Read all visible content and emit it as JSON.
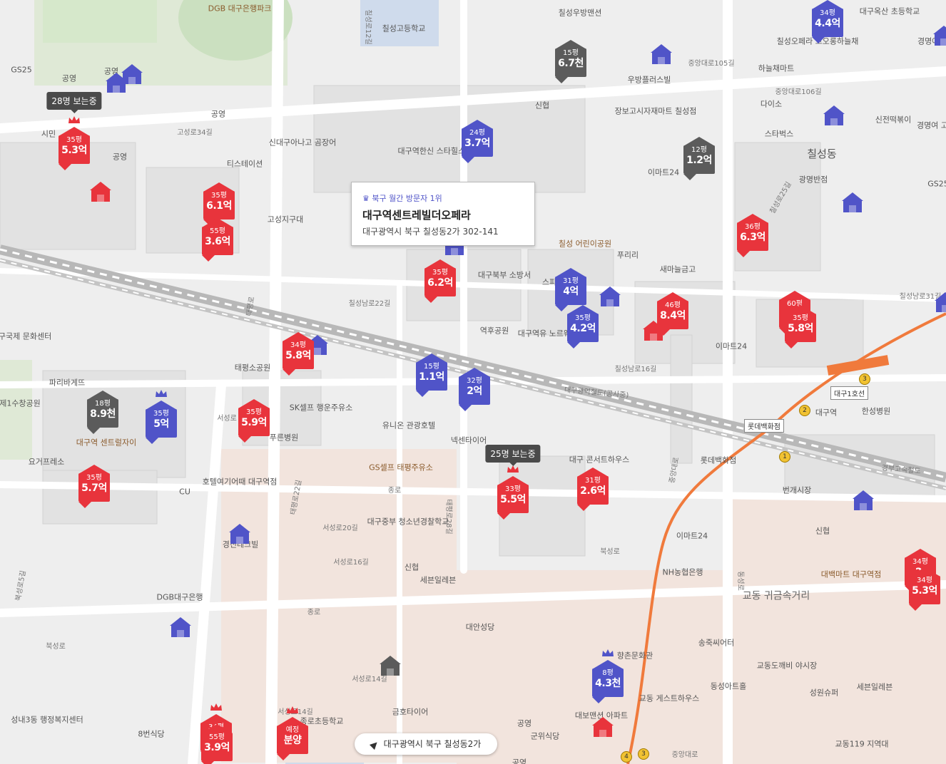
{
  "popup": {
    "rank_label": "♛ 북구 월간 방문자 1위",
    "name": "대구역센트레빌더오페라",
    "address": "대구광역시 북구 칠성동2가 302-141"
  },
  "location_bar": {
    "text": "대구광역시 북구 칠성동2가"
  },
  "viewing_badges": [
    {
      "text": "28명 보는중"
    },
    {
      "text": "25명 보는중"
    }
  ],
  "markers": [
    {
      "color": "red",
      "size": "35평",
      "price": "5.3억",
      "crown": true
    },
    {
      "color": "red",
      "size": "35평",
      "price": "6.1억",
      "crown": false
    },
    {
      "color": "red",
      "size": "55평",
      "price": "3.6억",
      "crown": false
    },
    {
      "color": "blue",
      "size": "24평",
      "price": "3.7억",
      "crown": false
    },
    {
      "color": "gray",
      "size": "15평",
      "price": "6.7천",
      "crown": false
    },
    {
      "color": "blue",
      "size": "34평",
      "price": "4.4억",
      "crown": false
    },
    {
      "color": "gray",
      "size": "12평",
      "price": "1.2억",
      "crown": false
    },
    {
      "color": "red",
      "size": "36평",
      "price": "6.3억",
      "crown": false
    },
    {
      "color": "red",
      "size": "35평",
      "price": "6.2억",
      "crown": false
    },
    {
      "color": "blue",
      "size": "31평",
      "price": "4억",
      "crown": false
    },
    {
      "color": "blue",
      "size": "35평",
      "price": "4.2억",
      "crown": false
    },
    {
      "color": "red",
      "size": "46평",
      "price": "8.4억",
      "crown": false
    },
    {
      "color": "red",
      "size": "60평",
      "price": "",
      "crown": false
    },
    {
      "color": "red",
      "size": "35평",
      "price": "5.8억",
      "crown": false
    },
    {
      "color": "red",
      "size": "34평",
      "price": "5.8억",
      "crown": false
    },
    {
      "color": "blue",
      "size": "15평",
      "price": "1.1억",
      "crown": false
    },
    {
      "color": "blue",
      "size": "32평",
      "price": "2억",
      "crown": false
    },
    {
      "color": "gray",
      "size": "18평",
      "price": "8.9천",
      "crown": false
    },
    {
      "color": "blue",
      "size": "35평",
      "price": "5억",
      "crown": true
    },
    {
      "color": "red",
      "size": "35평",
      "price": "5.9억",
      "crown": false
    },
    {
      "color": "red",
      "size": "35평",
      "price": "5.7억",
      "crown": false
    },
    {
      "color": "red",
      "size": "33평",
      "price": "5.5억",
      "crown": true
    },
    {
      "color": "red",
      "size": "31평",
      "price": "2.6억",
      "crown": false
    },
    {
      "color": "red",
      "size": "34평",
      "price": "2.",
      "crown": false
    },
    {
      "color": "red",
      "size": "34평",
      "price": "5.3억",
      "crown": false
    },
    {
      "color": "blue",
      "size": "8평",
      "price": "4.3천",
      "crown": true
    },
    {
      "color": "red",
      "size": "34평",
      "price": "",
      "crown": true
    },
    {
      "color": "red",
      "size": "55평",
      "price": "3.9억",
      "crown": false
    },
    {
      "color": "red",
      "size": "예정",
      "price": "분양",
      "crown": true
    }
  ],
  "houses": [
    {
      "color": "blue"
    },
    {
      "color": "red"
    },
    {
      "color": "blue"
    },
    {
      "color": "blue"
    },
    {
      "color": "blue"
    },
    {
      "color": "blue"
    },
    {
      "color": "blue"
    },
    {
      "color": "red"
    },
    {
      "color": "red"
    },
    {
      "color": "blue"
    },
    {
      "color": "blue"
    },
    {
      "color": "blue"
    },
    {
      "color": "gray"
    },
    {
      "color": "blue"
    },
    {
      "color": "blue"
    },
    {
      "color": "blue"
    },
    {
      "color": "blue"
    }
  ],
  "labels": {
    "place": [
      "DGB 대구은행파크",
      "칠성고등학교",
      "칠성우방맨션",
      "대구옥산 초등학교",
      "경명여 중학",
      "GS25",
      "공영",
      "공영",
      "칠성오페라 코오롱하늘채",
      "우방플러스빌",
      "하늘채마트",
      "다이소",
      "장보고시자재마트 칠성점",
      "신전떡볶이",
      "경명여 고등",
      "스타벅스",
      "칠성동",
      "광명반점",
      "GS25",
      "신대구아나고 곰장어",
      "시민",
      "티스테이션",
      "대구역한신 스타힐스아파트",
      "이마트24",
      "고성지구대",
      "칠성 어린이공원",
      "푸리리",
      "새마늘금고",
      "대구북부 소방서",
      "스피",
      "역후공원",
      "대구역유 노르웨이숲",
      "이마트24",
      "대구국제 문화센터",
      "파리바게뜨",
      "태평소공원",
      "SK셀프 행운주유소",
      "유니온 관광호텔",
      "넥센타이어",
      "제1수창공원",
      "대구역 센트럴자이",
      "요거프레소",
      "CU",
      "푸른병원",
      "호텔여기어때 대구역점",
      "GS셀프 태평주유소",
      "대구중부 청소년경찰학교",
      "대구 콘서트하우스",
      "롯데백화점",
      "번개시장",
      "신협",
      "한성병원",
      "대구역",
      "경진테크빌",
      "DGB대구은행",
      "세븐일레븐",
      "대안성당",
      "신협",
      "이마트24",
      "NH농협은행",
      "대백마트 대구역점",
      "교동 귀금속거리",
      "송죽씨어터",
      "교동도깨비 야시장",
      "동성아트홀",
      "성원슈퍼",
      "세븐일레븐",
      "향촌문화관",
      "교동 게스트하우스",
      "대보맨션 아파트",
      "금호타이어",
      "공영",
      "군위식당",
      "성내3동 행정복지센터",
      "8번식당",
      "종로초등학교",
      "교동119 지역대",
      "신협",
      "공영",
      "공영",
      "공영"
    ],
    "road": [
      "칠성로12길",
      "중앙대로105길",
      "중앙대로106길",
      "고성로34길",
      "칠성남로22길",
      "칠성남로16길",
      "칠성남로31길",
      "칠성로25길",
      "태평로22길",
      "태평로",
      "종로",
      "서성로20길",
      "서성로16길",
      "서성로14길",
      "서성로14길",
      "북성로",
      "북성로",
      "서성로",
      "태평로28길",
      "대구광역철도(공사중)",
      "중앙대로",
      "경부고속철도",
      "북성로5길",
      "동성로",
      "종로",
      "중앙대로"
    ],
    "station": [
      "대구1호선",
      "롯데백화점"
    ]
  }
}
